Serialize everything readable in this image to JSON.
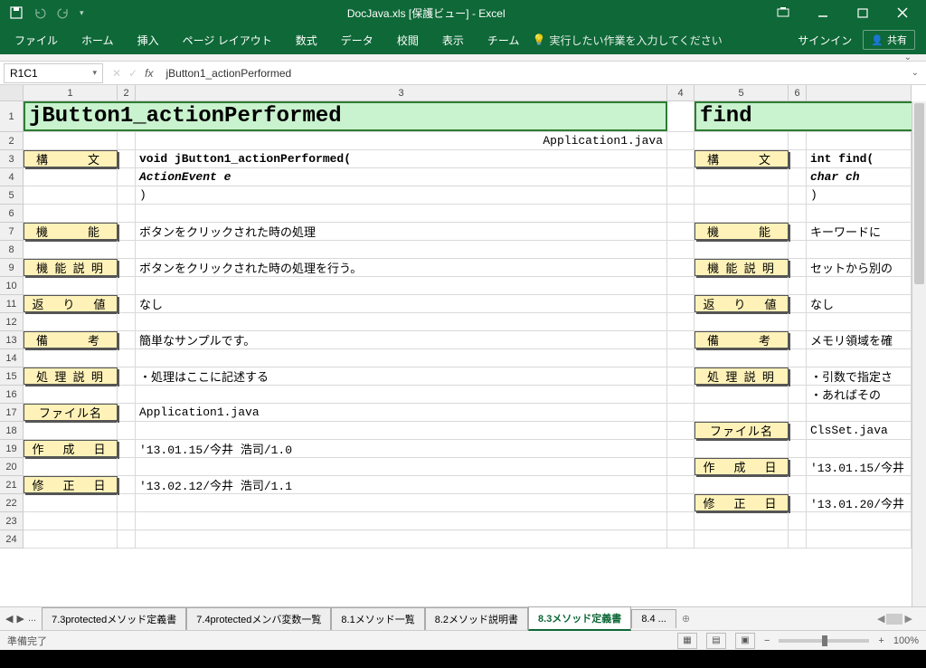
{
  "title": {
    "doc": "DocJava.xls",
    "mode": "[保護ビュー]",
    "app": "- Excel"
  },
  "qat": {
    "save": "save",
    "undo": "undo",
    "redo": "redo"
  },
  "ribbon": {
    "tabs": [
      "ファイル",
      "ホーム",
      "挿入",
      "ページ レイアウト",
      "数式",
      "データ",
      "校閲",
      "表示",
      "チーム"
    ],
    "tellme": "実行したい作業を入力してください",
    "signin": "サインイン",
    "share": "共有"
  },
  "namebox": "R1C1",
  "formula": "jButton1_actionPerformed",
  "cols": {
    "c1": "1",
    "c2": "2",
    "c3": "3",
    "c4": "4",
    "c5": "5",
    "c6": "6"
  },
  "rows": [
    "1",
    "2",
    "3",
    "4",
    "5",
    "6",
    "7",
    "8",
    "9",
    "10",
    "11",
    "12",
    "13",
    "14",
    "15",
    "16",
    "17",
    "18",
    "19",
    "20",
    "21",
    "22",
    "23",
    "24"
  ],
  "sheet1": {
    "title": "jButton1_actionPerformed",
    "file_top": "Application1.java",
    "labels": {
      "syntax": "構　　文",
      "function": "機　　能",
      "desc": "機 能 説 明",
      "return": "返　り　値",
      "note": "備　　考",
      "process": "処 理 説 明",
      "filename": "ファイル名",
      "created": "作　成　日",
      "modified": "修　正　日"
    },
    "syntax1": "void jButton1_actionPerformed(",
    "syntax2": "  ActionEvent e",
    "syntax3": ")",
    "function_v": "ボタンをクリックされた時の処理",
    "desc_v": "ボタンをクリックされた時の処理を行う。",
    "return_v": "なし",
    "note_v": "簡単なサンプルです。",
    "process_v": "・処理はここに記述する",
    "filename_v": "Application1.java",
    "created_v": "'13.01.15/今井 浩司/1.0",
    "modified_v": "'13.02.12/今井 浩司/1.1"
  },
  "sheet2": {
    "title": "find",
    "syntax1": "int find(",
    "syntax2": "  char ch",
    "syntax3": ")",
    "function_v": "キーワードに",
    "desc_v": "セットから別の",
    "return_v": "なし",
    "note_v": "メモリ領域を確",
    "process_v1": "・引数で指定さ",
    "process_v2": "・あればその",
    "filename_v": "ClsSet.java",
    "created_v": "'13.01.15/今井",
    "modified_v": "'13.01.20/今井"
  },
  "sheetTabs": {
    "nav_more": "...",
    "t1": "7.3protectedメソッド定義書",
    "t2": "7.4protectedメンバ変数一覧",
    "t3": "8.1メソッド一覧",
    "t4": "8.2メソッド説明書",
    "t5": "8.3メソッド定義書",
    "t6": "8.4 ...",
    "add": "⊕"
  },
  "status": {
    "ready": "準備完了",
    "zoom": "100%"
  }
}
